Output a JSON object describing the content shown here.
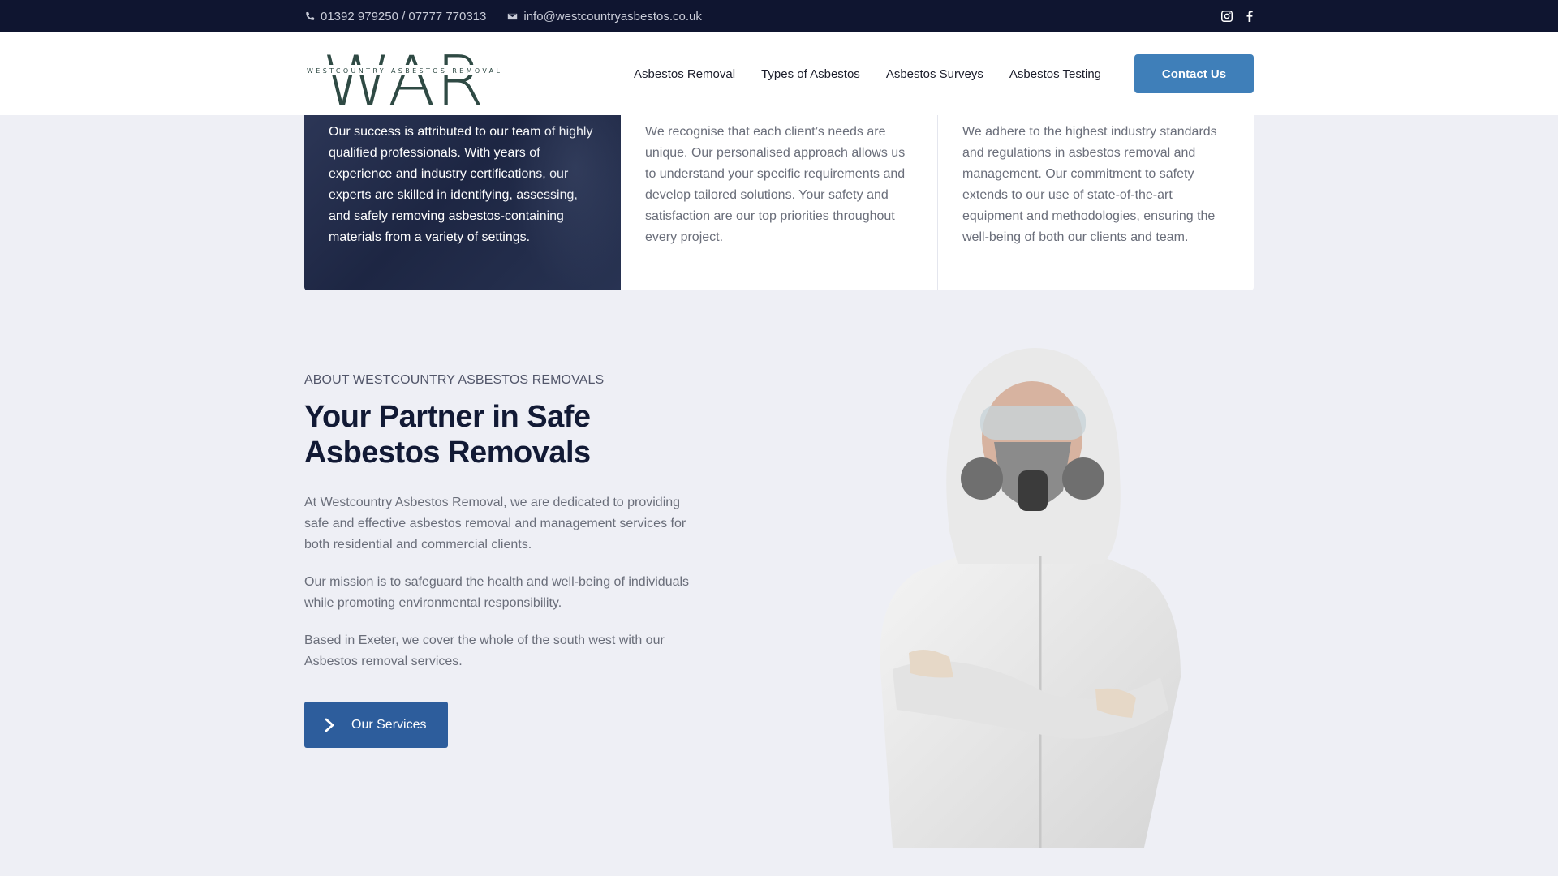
{
  "topbar": {
    "phone": "01392 979250 / 07777 770313",
    "email": "info@westcountryasbestos.co.uk",
    "social": [
      "instagram-icon",
      "facebook-icon"
    ]
  },
  "header": {
    "logo_letters": "WAR",
    "logo_tagline": "WESTCOUNTRY ASBESTOS REMOVAL",
    "nav": [
      "Asbestos Removal",
      "Types of Asbestos",
      "Asbestos Surveys",
      "Asbestos Testing"
    ],
    "cta": "Contact Us"
  },
  "cards": [
    "Our success is attributed to our team of highly qualified professionals. With years of experience and industry certifications, our experts are skilled in identifying, assessing, and safely removing asbestos-containing materials from a variety of settings.",
    "We recognise that each client’s needs are unique. Our personalised approach allows us to understand your specific requirements and develop tailored solutions. Your safety and satisfaction are our top priorities throughout every project.",
    "We adhere to the highest industry standards and regulations in asbestos removal and management. Our commitment to safety extends to our use of state-of-the-art equipment and methodologies, ensuring the well-being of both our clients and team."
  ],
  "about": {
    "eyebrow": "ABOUT WESTCOUNTRY ASBESTOS REMOVALS",
    "heading": "Your Partner in Safe Asbestos Removals",
    "paragraphs": [
      "At Westcountry Asbestos Removal, we are dedicated to providing safe and effective asbestos removal and management services for both residential and commercial clients.",
      "Our mission is to safeguard the health and well-being of individuals while promoting environmental responsibility.",
      "Based in Exeter, we cover the whole of the south west with our Asbestos removal services."
    ],
    "button": "Our Services"
  },
  "colors": {
    "topbar": "#0f1530",
    "accent": "#3f7fb9",
    "button": "#2d5d9c",
    "heading": "#121a35",
    "logo": "#2f4a44"
  }
}
